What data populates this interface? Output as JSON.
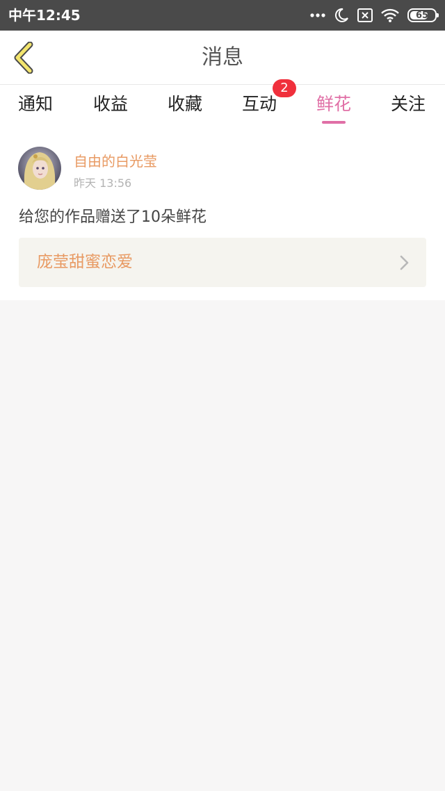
{
  "status_bar": {
    "time": "中午12:45",
    "battery_level": "65",
    "icons": [
      "more-dots-icon",
      "moon-icon",
      "sim-x-icon",
      "wifi-icon",
      "battery-icon"
    ]
  },
  "header": {
    "title": "消息",
    "back_icon": "chevron-left-icon"
  },
  "tabs": [
    {
      "label": "通知"
    },
    {
      "label": "收益"
    },
    {
      "label": "收藏"
    },
    {
      "label": "互动",
      "badge": "2"
    },
    {
      "label": "鲜花",
      "active": true
    },
    {
      "label": "关注"
    }
  ],
  "colors": {
    "accent": "#e06fa6",
    "name_orange": "#e89a63",
    "badge_red": "#f0303c",
    "status_bar": "#4a4a4a"
  },
  "messages": [
    {
      "user_name": "自由的白光莹",
      "timestamp": "昨天 13:56",
      "text": "给您的作品赠送了10朵鲜花",
      "work_title": "庞莹甜蜜恋爱"
    }
  ]
}
